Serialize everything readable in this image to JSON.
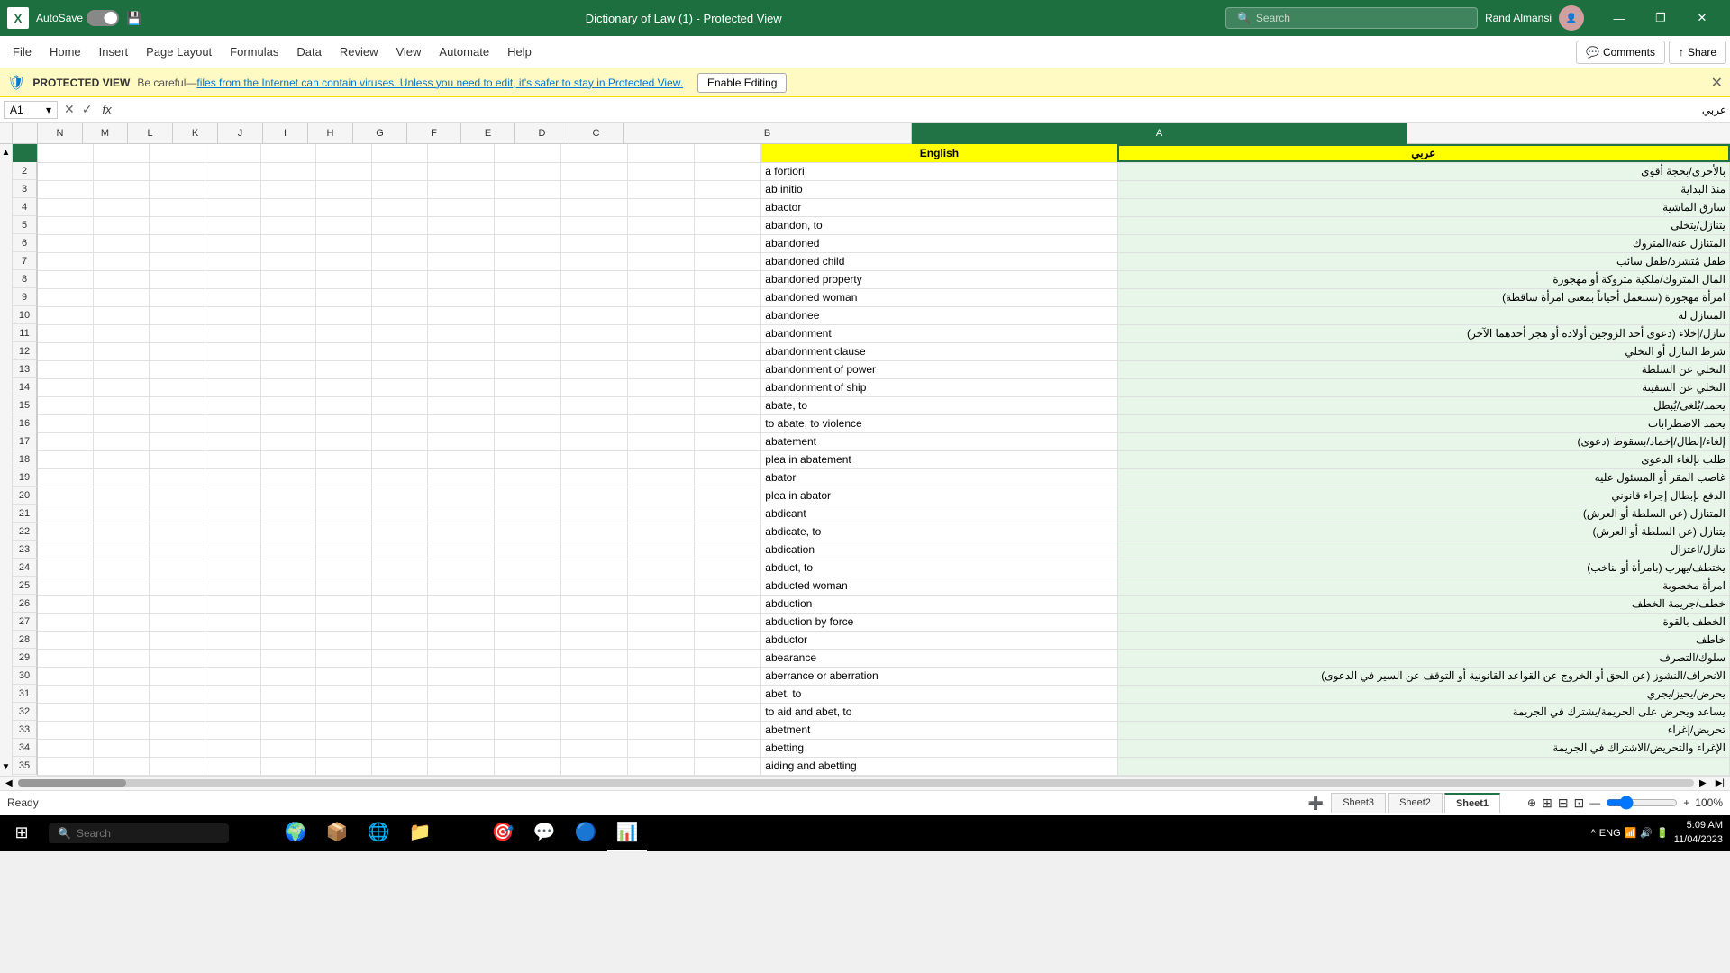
{
  "titlebar": {
    "app_label": "X",
    "autosave_label": "AutoSave",
    "toggle_state": "Off",
    "save_icon": "💾",
    "file_title": "Dictionary of Law (1)  -  Protected View",
    "dropdown_icon": "▾",
    "search_placeholder": "Search",
    "user_name": "Rand Almansi",
    "minimize": "—",
    "restore": "❐",
    "close": "✕"
  },
  "menubar": {
    "items": [
      "File",
      "Home",
      "Insert",
      "Page Layout",
      "Formulas",
      "Data",
      "Review",
      "View",
      "Automate",
      "Help"
    ],
    "comments_label": "Comments",
    "share_label": "Share"
  },
  "protectedbar": {
    "label": "PROTECTED VIEW",
    "message": "Be careful—files from the Internet can contain viruses. Unless you need to edit, it's safer to stay in Protected View.",
    "enable_label": "Enable Editing"
  },
  "formulabar": {
    "cell_ref": "A1",
    "cancel": "✕",
    "confirm": "✓",
    "fx": "fx",
    "value": "عربي"
  },
  "columns": {
    "headers": [
      "N",
      "M",
      "L",
      "K",
      "J",
      "I",
      "H",
      "G",
      "F",
      "E",
      "D",
      "C",
      "B",
      "A"
    ],
    "selected": "A"
  },
  "data": {
    "header_english": "English",
    "header_arabic": "عربي",
    "rows": [
      {
        "row": 2,
        "english": "a fortiori",
        "arabic": "بالأحرى/بحجة أقوى"
      },
      {
        "row": 3,
        "english": "ab initio",
        "arabic": "منذ البداية"
      },
      {
        "row": 4,
        "english": "abactor",
        "arabic": "سارق الماشية"
      },
      {
        "row": 5,
        "english": "abandon, to",
        "arabic": "يتنازل/يتخلى"
      },
      {
        "row": 6,
        "english": "abandoned",
        "arabic": "المتنازل عنه/المتروك"
      },
      {
        "row": 7,
        "english": "abandoned child",
        "arabic": "طفل مُتشرد/طفل سائب"
      },
      {
        "row": 8,
        "english": "abandoned property",
        "arabic": "المال المتروك/ملكية متروكة أو مهجورة"
      },
      {
        "row": 9,
        "english": "abandoned woman",
        "arabic": "امرأة مهجورة (تستعمل أحياناً بمعنى امرأة ساقطة)"
      },
      {
        "row": 10,
        "english": "abandonee",
        "arabic": "المتنازل له"
      },
      {
        "row": 11,
        "english": "abandonment",
        "arabic": "تنازل/إخلاء (دعوى أحد الزوجين أولاده أو هجر أحدهما الآخر)"
      },
      {
        "row": 12,
        "english": "abandonment clause",
        "arabic": "شرط التنازل أو التخلي"
      },
      {
        "row": 13,
        "english": "abandonment of power",
        "arabic": "التخلي عن السلطة"
      },
      {
        "row": 14,
        "english": "abandonment of ship",
        "arabic": "التخلي عن السفينة"
      },
      {
        "row": 15,
        "english": "abate, to",
        "arabic": "يحمد/يُلغى/يُبطل"
      },
      {
        "row": 16,
        "english": "to abate, to violence",
        "arabic": "يحمد الاضطرابات"
      },
      {
        "row": 17,
        "english": "abatement",
        "arabic": "إلغاء/إبطال/إخماد/بسقوط (دعوى)"
      },
      {
        "row": 18,
        "english": "plea in abatement",
        "arabic": "طلب بإلغاء الدعوى"
      },
      {
        "row": 19,
        "english": "abator",
        "arabic": "غاصب المقر أو المسئول عليه"
      },
      {
        "row": 20,
        "english": "plea in abator",
        "arabic": "الدفع بإبطال إجراء قانوني"
      },
      {
        "row": 21,
        "english": "abdicant",
        "arabic": "المتنازل (عن السلطة أو العرش)"
      },
      {
        "row": 22,
        "english": "abdicate, to",
        "arabic": "يتنازل (عن السلطة أو العرش)"
      },
      {
        "row": 23,
        "english": "abdication",
        "arabic": "تنازل/اعتزال"
      },
      {
        "row": 24,
        "english": "abduct, to",
        "arabic": "يختطف/يهرب (بامرأة أو بناخب)"
      },
      {
        "row": 25,
        "english": "abducted woman",
        "arabic": "امرأة مخصوبة"
      },
      {
        "row": 26,
        "english": "abduction",
        "arabic": "خطف/جريمة الخطف"
      },
      {
        "row": 27,
        "english": "abduction by force",
        "arabic": "الخطف بالقوة"
      },
      {
        "row": 28,
        "english": "abductor",
        "arabic": "خاطف"
      },
      {
        "row": 29,
        "english": "abearance",
        "arabic": "سلوك/التصرف"
      },
      {
        "row": 30,
        "english": "aberrance or aberration",
        "arabic": "الانحراف/النشوز (عن الحق أو الخروج عن القواعد القانونية أو التوقف عن السير في الدعوى)"
      },
      {
        "row": 31,
        "english": "abet, to",
        "arabic": "يحرض/يحيز/يجري"
      },
      {
        "row": 32,
        "english": "to aid and abet, to",
        "arabic": "يساعد ويحرض على الجريمة/يشترك في الجريمة"
      },
      {
        "row": 33,
        "english": "abetment",
        "arabic": "تحريض/إغراء"
      },
      {
        "row": 34,
        "english": "abetting",
        "arabic": "الإغراء والتحريض/الاشتراك في الجريمة"
      },
      {
        "row": 35,
        "english": "aiding and abetting",
        "arabic": ""
      }
    ]
  },
  "sheets": [
    "Sheet3",
    "Sheet2",
    "Sheet1"
  ],
  "active_sheet": "Sheet1",
  "status": "Ready",
  "zoom": "100%",
  "taskbar": {
    "search_placeholder": "Search",
    "time": "5:09 AM",
    "date": "11/04/2023",
    "lang": "ENG"
  }
}
